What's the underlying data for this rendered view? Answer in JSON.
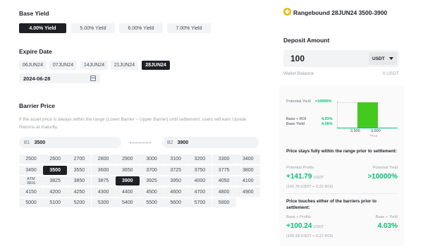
{
  "base_yield": {
    "label": "Base Yield",
    "options": [
      "4.00% Yield",
      "5.00% Yield",
      "6.00% Yield",
      "7.00% Yield"
    ],
    "selected_index": 0
  },
  "expire_date": {
    "label": "Expire Date",
    "options": [
      "06JUN24",
      "07JUN24",
      "14JUN24",
      "21JUN24",
      "28JUN24"
    ],
    "selected_index": 4,
    "field_value": "2024-06-28"
  },
  "barrier": {
    "label": "Barrier Price",
    "description": "If the asset price is always within the range (Lower Barrier ~ Upper Barrier) until settlement, users will earn Upside Returns at maturity.",
    "b1_prefix": "B1",
    "b1_value": "3500",
    "b2_prefix": "B2",
    "b2_value": "3900",
    "atm_label": "ATM",
    "atm_price": "3816",
    "grid": [
      [
        "2500",
        "2600",
        "2700",
        "2800",
        "2900",
        "3000",
        "3100",
        "3200",
        "3300",
        "3400"
      ],
      [
        "3450",
        "3500",
        "3550",
        "3600",
        "3650",
        "3700",
        "3725",
        "3750",
        "3775",
        "3800"
      ],
      [
        "ATM",
        "3825",
        "3850",
        "3875",
        "3900",
        "3925",
        "3950",
        "4000",
        "4050",
        "4100"
      ],
      [
        "4150",
        "4200",
        "4250",
        "4300",
        "4400",
        "4500",
        "4600",
        "4700",
        "4800",
        "4900"
      ],
      [
        "5000",
        "5100",
        "5200",
        "5300",
        "5400",
        "5500",
        "5600",
        "5700",
        "5800",
        ""
      ]
    ],
    "selected": [
      "3500",
      "3900"
    ]
  },
  "product": {
    "title": "Rangebound 28JUN24 3500-3900",
    "icon": "bnb-logo-icon"
  },
  "deposit": {
    "label": "Deposit Amount",
    "amount": "100",
    "currency": "USDT",
    "wallet_label": "Wallet Balance",
    "wallet_value": "0 USDT"
  },
  "chart": {
    "potential_yield_label": "Potential Yield",
    "potential_yield_value": ">10000%",
    "base_roi_label": "Base + ROI",
    "base_roi_value": "4.03%",
    "base_yield_label": "Base Yield",
    "base_yield_value": "4.00%",
    "low": "3,500",
    "high": "3,900",
    "axis_label": "Price"
  },
  "within_range": {
    "heading": "Price stays fully within the range prior to settlement:",
    "profit_label": "Potential Profits",
    "profit_value": "+141.79",
    "profit_unit": "USDT",
    "yield_label": "Potential Yield",
    "yield_value": ">10000%",
    "breakdown": "(141.79 USDT + 0.22 ROI)"
  },
  "touches_barrier": {
    "heading": "Price touches either of the barriers prior to settlement:",
    "profit_label": "Base + Profits",
    "profit_value": "+100.24",
    "profit_unit": "USDT",
    "yield_label": "Base + Yield",
    "yield_value": "4.03%",
    "breakdown": "(100.24 USDT + 0.22 ROI)"
  },
  "colors": {
    "accent_green": "#02c076",
    "dark": "#1e2026",
    "brand_yellow": "#f0b90b"
  }
}
